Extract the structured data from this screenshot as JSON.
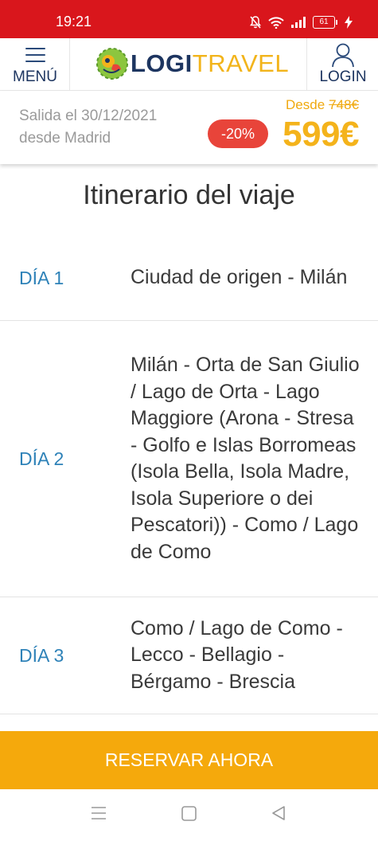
{
  "status_bar": {
    "time": "19:21",
    "battery": "61",
    "icons": [
      "mute-icon",
      "wifi-icon",
      "signal-icon",
      "battery-icon",
      "charging-icon"
    ]
  },
  "header": {
    "menu_label": "MENÚ",
    "logo_primary": "LOGI",
    "logo_secondary": "TRAVEL",
    "login_label": "LOGIN"
  },
  "price_bar": {
    "departure_line1": "Salida el 30/12/2021",
    "departure_line2": "desde Madrid",
    "from_label": "Desde",
    "old_price": "748€",
    "discount": "-20%",
    "price": "599€"
  },
  "main": {
    "title": "Itinerario del viaje",
    "days": [
      {
        "label": "DÍA 1",
        "description": "Ciudad de origen - Milán"
      },
      {
        "label": "DÍA 2",
        "description": "Milán - Orta de San Giulio / Lago de Orta - Lago Maggiore (Arona - Stresa - Golfo e Islas Borromeas (Isola Bella, Isola Madre, Isola Superiore o dei Pescatori)) - Como / Lago de Como"
      },
      {
        "label": "DÍA 3",
        "description": "Como / Lago de Como - Lecco - Bellagio - Bérgamo - Brescia"
      }
    ]
  },
  "cta": {
    "reserve_label": "RESERVAR AHORA"
  },
  "colors": {
    "status_red": "#d9161c",
    "brand_navy": "#1d3560",
    "brand_yellow": "#f2b41b",
    "discount_red": "#e8443a",
    "day_blue": "#2e82b8",
    "button_orange": "#f5a90c"
  },
  "nav_bar": {
    "icons": [
      "recent-apps-icon",
      "home-icon",
      "back-icon"
    ]
  }
}
